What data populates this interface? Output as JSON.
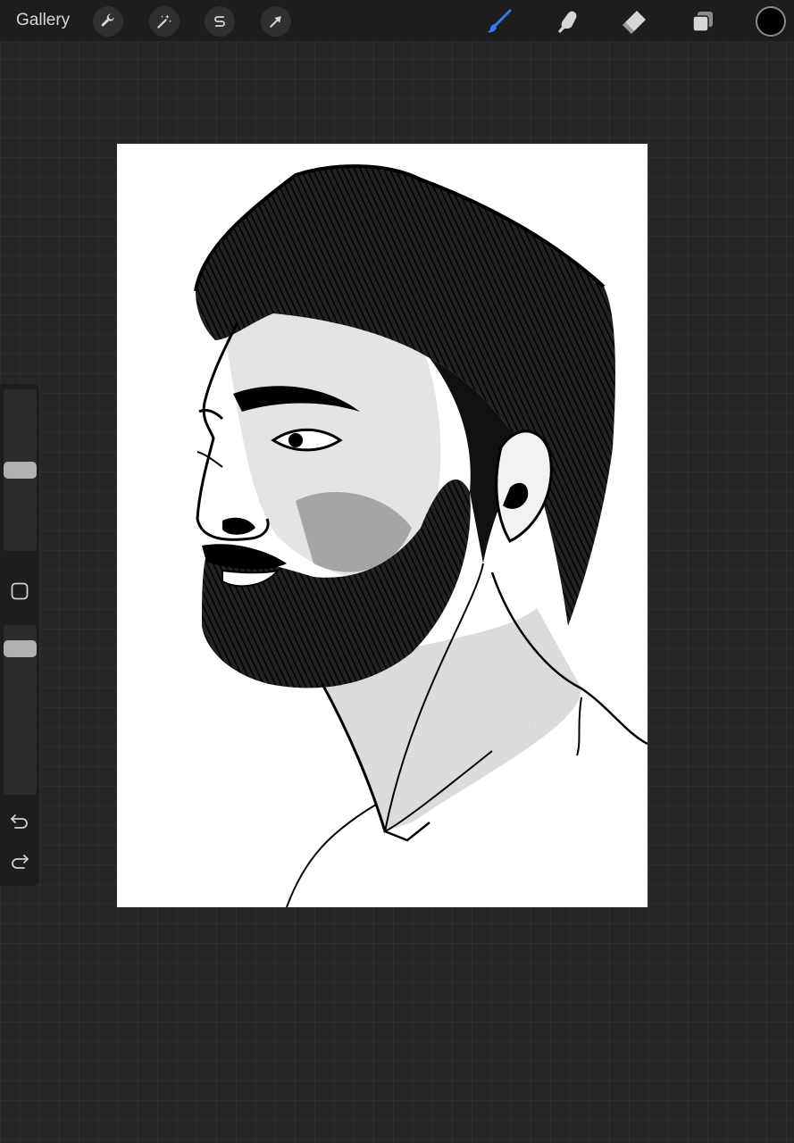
{
  "toolbar": {
    "gallery_label": "Gallery",
    "left_tools": [
      {
        "name": "actions",
        "icon": "wrench-icon"
      },
      {
        "name": "adjustments",
        "icon": "magic-wand-icon"
      },
      {
        "name": "selection",
        "icon": "selection-s-icon"
      },
      {
        "name": "transform",
        "icon": "arrow-cursor-icon"
      }
    ],
    "right_tools": [
      {
        "name": "brush",
        "icon": "brush-icon",
        "active": true
      },
      {
        "name": "smudge",
        "icon": "smudge-finger-icon",
        "active": false
      },
      {
        "name": "eraser",
        "icon": "eraser-icon",
        "active": false
      },
      {
        "name": "layers",
        "icon": "layers-icon",
        "active": false
      }
    ],
    "current_color": "#000000",
    "active_color": "#2f7cf6"
  },
  "sidebar": {
    "brush_size_level": 0.5,
    "opacity_level": 0.9,
    "actions": [
      {
        "name": "undo",
        "icon": "undo-arrow-icon"
      },
      {
        "name": "redo",
        "icon": "redo-arrow-icon"
      }
    ]
  },
  "canvas": {
    "background": "#ffffff",
    "content": "sketch-portrait-drawing"
  }
}
